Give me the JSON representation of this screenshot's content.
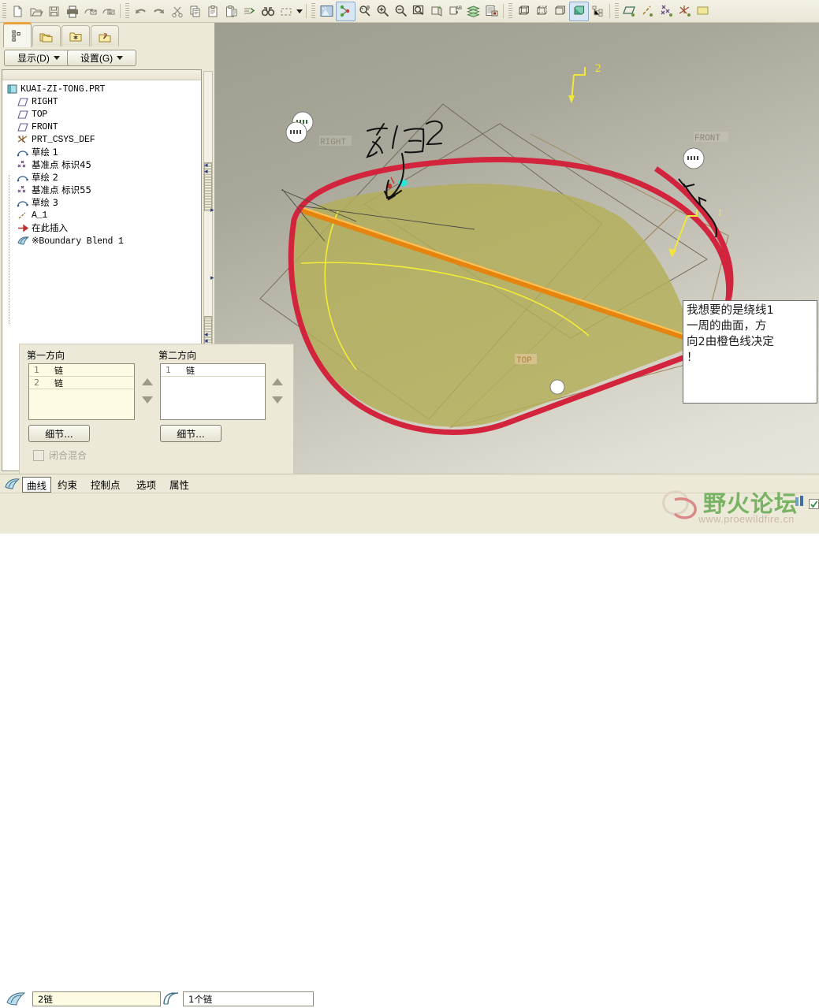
{
  "window": {
    "title": "KUAI-ZI-TONG.PRT",
    "canvas_bg_top": "#9e9d90",
    "canvas_bg_bottom": "#e7e5da"
  },
  "toolbar": {
    "groups": [
      {
        "name": "file",
        "buttons": [
          {
            "name": "new-icon",
            "label": "New",
            "glyph": "page"
          },
          {
            "name": "open-icon",
            "label": "Open",
            "glyph": "folder-open"
          },
          {
            "name": "save-icon",
            "label": "Save",
            "glyph": "floppy"
          },
          {
            "name": "print-icon",
            "label": "Print",
            "glyph": "printer"
          },
          {
            "name": "send-mail-icon",
            "label": "Send",
            "glyph": "mail"
          },
          {
            "name": "send-link-icon",
            "label": "Send Link",
            "glyph": "mail2"
          }
        ]
      },
      {
        "name": "edit",
        "buttons": [
          {
            "name": "undo-icon",
            "label": "Undo",
            "glyph": "undo"
          },
          {
            "name": "redo-icon",
            "label": "Redo",
            "glyph": "redo"
          },
          {
            "name": "cut-icon",
            "label": "Cut",
            "glyph": "scissors"
          },
          {
            "name": "copy-icon",
            "label": "Copy",
            "glyph": "copy"
          },
          {
            "name": "paste-icon",
            "label": "Paste",
            "glyph": "paste"
          },
          {
            "name": "paste-special-icon",
            "label": "Paste Special",
            "glyph": "paste2"
          },
          {
            "name": "regenerate-icon",
            "label": "Regenerate",
            "glyph": "regen"
          },
          {
            "name": "find-icon",
            "label": "Find",
            "glyph": "binoculars"
          },
          {
            "name": "selection-filter-icon",
            "label": "Selection Filter",
            "glyph": "marquee"
          }
        ]
      },
      {
        "name": "view",
        "buttons": [
          {
            "name": "repaint-icon",
            "label": "Repaint",
            "glyph": "repaint"
          },
          {
            "name": "spin-center-icon",
            "label": "Spin Center",
            "glyph": "spincenter",
            "selected": true
          },
          {
            "name": "orientation-icon",
            "label": "Reorient",
            "glyph": "reorient"
          },
          {
            "name": "zoom-in-icon",
            "label": "Zoom In",
            "glyph": "zoomin"
          },
          {
            "name": "zoom-out-icon",
            "label": "Zoom Out",
            "glyph": "zoomout"
          },
          {
            "name": "refit-icon",
            "label": "Refit",
            "glyph": "refit"
          },
          {
            "name": "view-manager-icon",
            "label": "View Manager",
            "glyph": "viewmgr"
          },
          {
            "name": "annotation-icon",
            "label": "Annotation",
            "glyph": "ab"
          },
          {
            "name": "layers-icon",
            "label": "Layers",
            "glyph": "layers"
          },
          {
            "name": "model-player-icon",
            "label": "Model Player",
            "glyph": "player"
          }
        ]
      },
      {
        "name": "display-style",
        "buttons": [
          {
            "name": "wireframe-icon",
            "label": "Wireframe",
            "glyph": "wire"
          },
          {
            "name": "hidden-line-icon",
            "label": "Hidden Line",
            "glyph": "hidline"
          },
          {
            "name": "no-hidden-icon",
            "label": "No Hidden",
            "glyph": "nohid"
          },
          {
            "name": "shading-icon",
            "label": "Shading",
            "glyph": "shade",
            "selected": true
          },
          {
            "name": "model-tree-icon",
            "label": "Model Tree",
            "glyph": "tree"
          }
        ]
      },
      {
        "name": "datum-display",
        "buttons": [
          {
            "name": "datum-plane-icon",
            "label": "Datum Planes",
            "glyph": "dplane"
          },
          {
            "name": "datum-axis-icon",
            "label": "Datum Axes",
            "glyph": "daxis"
          },
          {
            "name": "datum-point-icon",
            "label": "Datum Points",
            "glyph": "dpoint"
          },
          {
            "name": "datum-csys-icon",
            "label": "Coordinate Systems",
            "glyph": "dcsys"
          },
          {
            "name": "datum-extra-icon",
            "label": "Datum",
            "glyph": "dextra"
          }
        ]
      }
    ]
  },
  "navigator": {
    "tabs": [
      {
        "name": "model-tree-tab",
        "label": "Model Tree",
        "glyph": "modeltree",
        "active": true
      },
      {
        "name": "folder-browser-tab",
        "label": "Folder Browser",
        "glyph": "folders",
        "active": false
      },
      {
        "name": "favorites-tab",
        "label": "Favorites",
        "glyph": "favorites",
        "active": false
      },
      {
        "name": "connections-tab",
        "label": "Connections",
        "glyph": "tools",
        "active": false
      }
    ],
    "menus": [
      {
        "name": "display-menu",
        "label": "显示(D)"
      },
      {
        "name": "settings-menu",
        "label": "设置(G)"
      }
    ]
  },
  "model_tree": {
    "root": {
      "label": "KUAI-ZI-TONG.PRT",
      "icon": "part-icon",
      "mono": true
    },
    "items": [
      {
        "label": "RIGHT",
        "icon": "datum-plane-icon",
        "mono": true
      },
      {
        "label": "TOP",
        "icon": "datum-plane-icon",
        "mono": true
      },
      {
        "label": "FRONT",
        "icon": "datum-plane-icon",
        "mono": true
      },
      {
        "label": "PRT_CSYS_DEF",
        "icon": "csys-icon",
        "mono": true
      },
      {
        "label": "草绘 1",
        "icon": "sketch-icon",
        "mono": false
      },
      {
        "label": "基准点 标识45",
        "icon": "datum-point-icon",
        "mono": false
      },
      {
        "label": "草绘 2",
        "icon": "sketch-icon",
        "mono": false
      },
      {
        "label": "基准点 标识55",
        "icon": "datum-point-icon",
        "mono": false
      },
      {
        "label": "草绘 3",
        "icon": "sketch-icon",
        "mono": false
      },
      {
        "label": "A_1",
        "icon": "datum-axis-icon",
        "mono": true
      },
      {
        "label": "在此插入",
        "icon": "insert-here-icon",
        "mono": false
      },
      {
        "label": "※Boundary Blend 1",
        "icon": "boundary-blend-icon",
        "mono": true
      }
    ]
  },
  "dashboard": {
    "first_direction": {
      "label": "第一方向",
      "rows": [
        {
          "num": "1",
          "value": "链"
        },
        {
          "num": "2",
          "value": "链"
        }
      ],
      "details_button": "细节...",
      "move_up": "move-up-arrow",
      "move_down": "move-down-arrow"
    },
    "second_direction": {
      "label": "第二方向",
      "rows": [
        {
          "num": "1",
          "value": "链"
        }
      ],
      "details_button": "细节...",
      "move_up": "move-up-arrow",
      "move_down": "move-down-arrow"
    },
    "closed_blend": {
      "label": "闭合混合",
      "checked": false,
      "disabled": true
    }
  },
  "bottom_tabs": {
    "icon": "boundary-blend-icon",
    "items": [
      {
        "label": "曲线",
        "active": true
      },
      {
        "label": "约束",
        "active": false
      },
      {
        "label": "控制点",
        "active": false
      },
      {
        "label": "选项",
        "active": false
      },
      {
        "label": "属性",
        "active": false
      }
    ]
  },
  "collectors": [
    {
      "name": "first-direction-collector",
      "icon": "surface-icon",
      "value": "2链",
      "highlight": true
    },
    {
      "name": "second-direction-collector",
      "icon": "curves-icon",
      "value": "1个链",
      "highlight": false
    }
  ],
  "graphics": {
    "note": {
      "lines": [
        "我想要的是绕线1",
        "一周的曲面，方",
        "向2由橙色线决定",
        "！"
      ],
      "text": "我想要的是绕线1一周的曲面，方向2由橙色线决定！"
    },
    "sketch_annotation": "方向2",
    "datum_labels": [
      {
        "name": "right-plane-label",
        "text": "RIGHT"
      },
      {
        "name": "front-plane-label",
        "text": "FRONT"
      },
      {
        "name": "top-plane-label",
        "text": "TOP"
      }
    ],
    "direction_arrows": [
      {
        "name": "direction-2-arrow",
        "label": "2"
      },
      {
        "name": "direction-1-arrow",
        "label": "1"
      }
    ],
    "colors": {
      "highlight_curve": "#d0243c",
      "orange_curve": "#f2951d",
      "yellow_curve": "#f5f02a",
      "surface_fill": "#b5b05a",
      "datum_plane": "#a18a64"
    }
  },
  "watermark": {
    "title": "野火论坛",
    "url": "www.proewildfire.cn"
  }
}
